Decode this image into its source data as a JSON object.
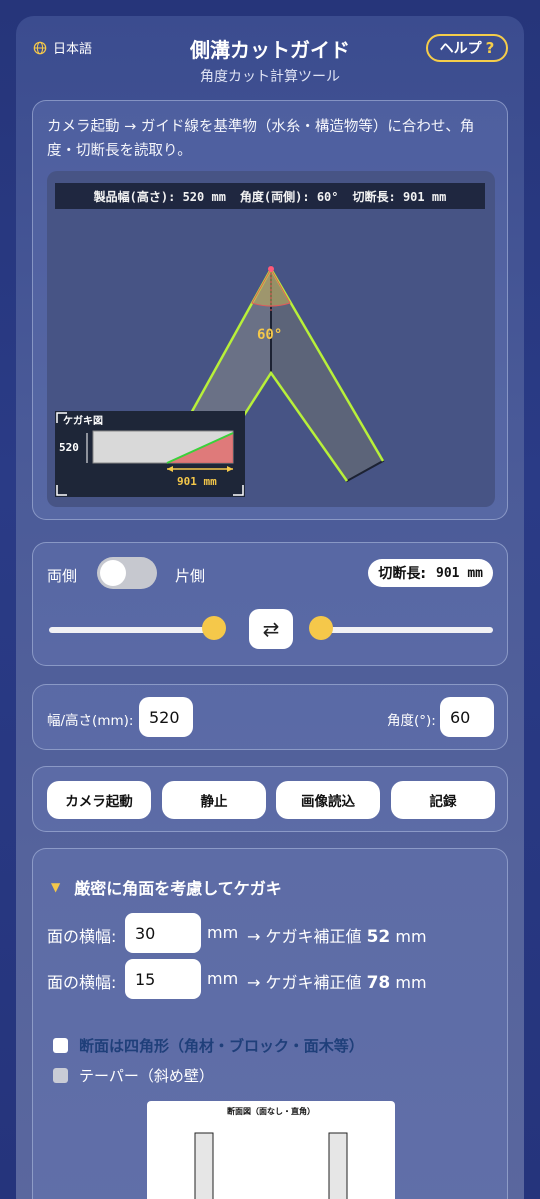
{
  "header": {
    "language": "日本語",
    "title": "側溝カットガイド",
    "subtitle": "角度カット計算ツール",
    "help_label": "ヘルプ",
    "help_mark": "?"
  },
  "camera_panel": {
    "instruction": "カメラ起動 → ガイド線を基準物（水糸・構造物等）に合わせ、角度・切断長を読取り。",
    "overlay": {
      "width_text": "製品幅(高さ): 520 mm",
      "angle_text": "角度(両側): 60°",
      "cut_text": "切断長: 901 mm"
    },
    "angle_label": "60°",
    "marking_box": {
      "title": "ケガキ図",
      "height_label": "520",
      "length_label": "901 mm"
    }
  },
  "mode_panel": {
    "both_label": "両側",
    "single_label": "片側",
    "toggle_on": false,
    "cut_length_label": "切断長:",
    "cut_length_value": "901 mm",
    "swap_icon": "⇄",
    "left_slider_value": 0.94,
    "right_slider_value": 0.0
  },
  "inputs": {
    "width_label": "幅/高さ(mm):",
    "width_value": "520",
    "angle_label": "角度(°):",
    "angle_value": "60"
  },
  "actions": [
    "カメラ起動",
    "静止",
    "画像読込",
    "記録"
  ],
  "precise": {
    "heading": "厳密に角面を考慮してケガキ",
    "rows": [
      {
        "label": "面の横幅:",
        "value": "30",
        "unit": "mm",
        "result_prefix": "→ ケガキ補正値",
        "result_value": "52",
        "result_unit": "mm"
      },
      {
        "label": "面の横幅:",
        "value": "15",
        "unit": "mm",
        "result_prefix": "→ ケガキ補正値",
        "result_value": "78",
        "result_unit": "mm"
      }
    ],
    "checkbox_square": "断面は四角形（角材・ブロック・面木等）",
    "checkbox_taper": "テーパー（斜め壁）",
    "section_caption": "断面図（面なし・直角）"
  },
  "colors": {
    "accent_yellow": "#f5c84a",
    "guide_green": "#b8f03a",
    "cut_red": "#e05a5a"
  }
}
